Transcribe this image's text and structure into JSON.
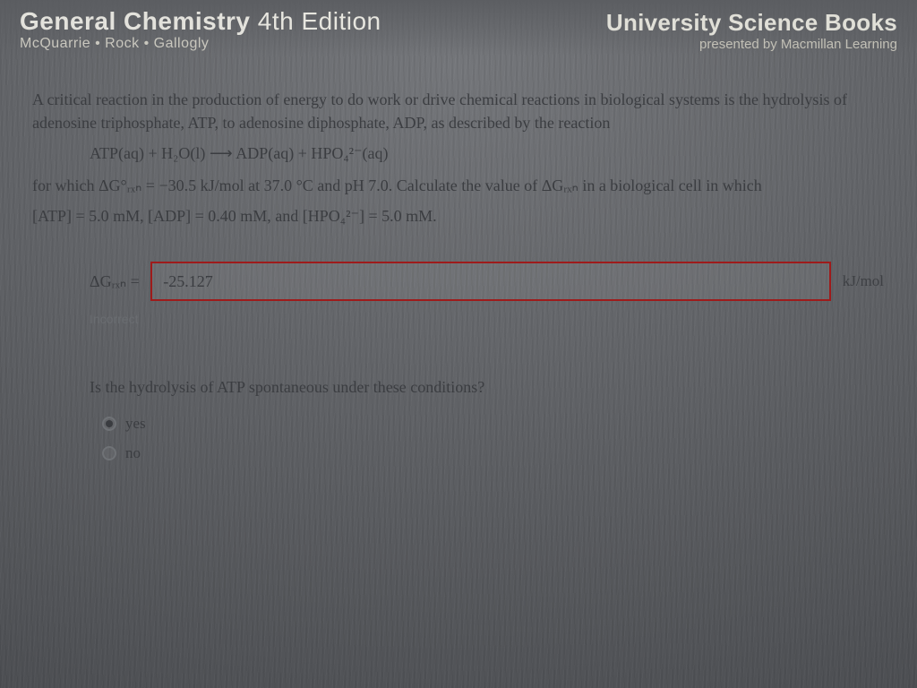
{
  "banner": {
    "title_main_a": "General Chemistry",
    "title_main_b": "4th Edition",
    "title_sub": "McQuarrie • Rock • Gallogly",
    "pub_main": "University Science Books",
    "pub_sub": "presented by Macmillan Learning"
  },
  "problem": {
    "p1": "A critical reaction in the production of energy to do work or drive chemical reactions in biological systems is the hydrolysis of adenosine triphosphate, ATP, to adenosine diphosphate, ADP, as described by the reaction",
    "equation_lhs": "ATP(aq) + H₂O(l)",
    "equation_arrow": "⟶",
    "equation_rhs": "ADP(aq) + HPO₄²⁻(aq)",
    "p2a": "for which ΔG°ᵣₓₙ = ",
    "dG_std_value": "−30.5 kJ/mol",
    "p2b": " at 37.0 °C and pH 7.0. Calculate the value of ΔGᵣₓₙ in a biological cell in which",
    "p3": "[ATP] = 5.0 mM, [ADP] = 0.40 mM, and [HPO₄²⁻] = 5.0 mM."
  },
  "answer": {
    "label": "ΔGᵣₓₙ =",
    "value": "-25.127",
    "unit": "kJ/mol",
    "feedback": "Incorrect"
  },
  "question2": {
    "prompt": "Is the hydrolysis of ATP spontaneous under these conditions?",
    "options": [
      {
        "label": "yes",
        "selected": true
      },
      {
        "label": "no",
        "selected": false
      }
    ]
  }
}
